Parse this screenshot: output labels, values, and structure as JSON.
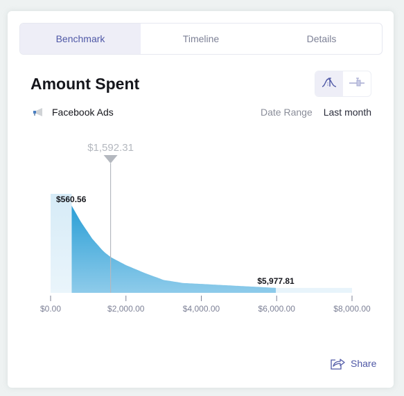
{
  "tabs": [
    {
      "label": "Benchmark",
      "active": true
    },
    {
      "label": "Timeline",
      "active": false
    },
    {
      "label": "Details",
      "active": false
    }
  ],
  "header": {
    "title": "Amount Spent"
  },
  "view_toggle": [
    {
      "icon": "distribution-curve-icon",
      "active": true
    },
    {
      "icon": "box-plot-icon",
      "active": false
    }
  ],
  "source": {
    "icon": "megaphone-icon",
    "label": "Facebook Ads"
  },
  "date_range": {
    "label": "Date Range",
    "value": "Last month"
  },
  "share": {
    "icon": "share-icon",
    "label": "Share"
  },
  "colors": {
    "accent": "#4f58a6",
    "curve_dark": "#2b9fd6",
    "curve_light": "#8ecbea",
    "band_light": "#e3f1fa",
    "marker": "#b4b8bf"
  },
  "chart_data": {
    "type": "area",
    "title": "Amount Spent",
    "xlabel": "",
    "ylabel": "",
    "xlim": [
      0,
      8000
    ],
    "x_ticks": [
      0,
      2000,
      4000,
      6000,
      8000
    ],
    "x_tick_labels": [
      "$0.00",
      "$2,000.00",
      "$4,000.00",
      "$6,000.00",
      "$8,000.00"
    ],
    "range_low": {
      "value": 560.56,
      "label": "$560.56"
    },
    "range_high": {
      "value": 5977.81,
      "label": "$5,977.81"
    },
    "marker": {
      "value": 1592.31,
      "label": "$1,592.31"
    },
    "density_curve": {
      "x": [
        0,
        560.56,
        800,
        1100,
        1400,
        1600,
        2000,
        2500,
        3000,
        3500,
        4000,
        4500,
        5000,
        5500,
        5977.81,
        8000
      ],
      "y": [
        1.0,
        0.88,
        0.72,
        0.55,
        0.42,
        0.36,
        0.28,
        0.2,
        0.13,
        0.1,
        0.09,
        0.08,
        0.07,
        0.06,
        0.05,
        0.05
      ]
    },
    "grid": false,
    "legend": "none"
  }
}
